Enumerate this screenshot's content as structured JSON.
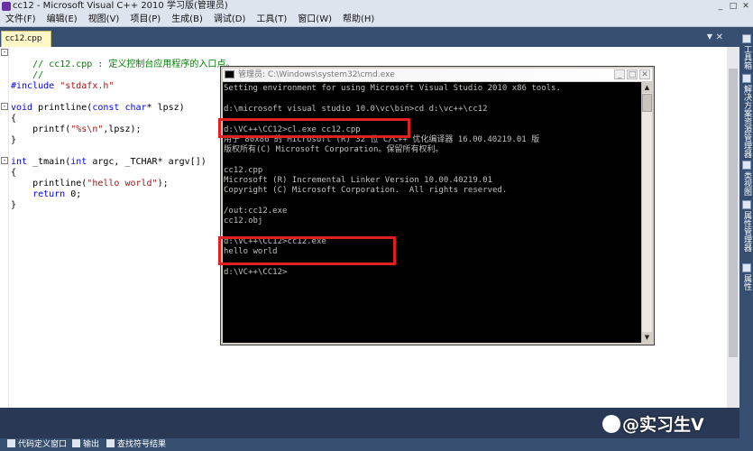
{
  "window": {
    "title": "cc12 - Microsoft Visual C++ 2010 学习版(管理员)",
    "controls": [
      "_",
      "□",
      "✕"
    ]
  },
  "menu": [
    "文件(F)",
    "编辑(E)",
    "视图(V)",
    "项目(P)",
    "生成(B)",
    "调试(D)",
    "工具(T)",
    "窗口(W)",
    "帮助(H)"
  ],
  "tab": {
    "label": "cc12.cpp"
  },
  "code": {
    "l1": "// cc12.cpp : 定义控制台应用程序的入口点。",
    "l2": "//",
    "l3a": "#include",
    "l3b": " \"stdafx.h\"",
    "l4a": "void",
    "l4b": " printline(",
    "l4c": "const char",
    "l4d": "* lpsz)",
    "l5": "{",
    "l6a": "    printf(",
    "l6b": "\"%s\\n\"",
    "l6c": ",lpsz);",
    "l7": "}",
    "l8a": "int",
    "l8b": " _tmain(",
    "l8c": "int",
    "l8d": " argc, _TCHAR* argv[])",
    "l9": "{",
    "l10a": "    printline(",
    "l10b": "\"hello world\"",
    "l10c": ");",
    "l11a": "    return",
    "l11b": " 0;",
    "l12": "}"
  },
  "cmd": {
    "title": "管理员:  C:\\Windows\\system32\\cmd.exe",
    "lines": [
      "Setting environment for using Microsoft Visual Studio 2010 x86 tools.",
      "",
      "d:\\microsoft visual studio 10.0\\vc\\bin>cd d:\\vc++\\cc12",
      "",
      "d:\\VC++\\CC12>cl.exe cc12.cpp",
      "用于 80x86 的 Microsoft (R) 32 位 C/C++ 优化编译器 16.00.40219.01 版",
      "版权所有(C) Microsoft Corporation。保留所有权利。",
      "",
      "cc12.cpp",
      "Microsoft (R) Incremental Linker Version 10.00.40219.01",
      "Copyright (C) Microsoft Corporation.  All rights reserved.",
      "",
      "/out:cc12.exe",
      "cc12.obj",
      "",
      "d:\\VC++\\CC12>cc12.exe",
      "hello world",
      "",
      "d:\\VC++\\CC12>"
    ]
  },
  "right_dock": [
    "工具箱",
    "解决方案资源管理器",
    "类视图",
    "属性管理器",
    "属性"
  ],
  "bottom_panels": [
    "代码定义窗口",
    "输出",
    "查找符号结果"
  ],
  "watermark": "@实习生V"
}
